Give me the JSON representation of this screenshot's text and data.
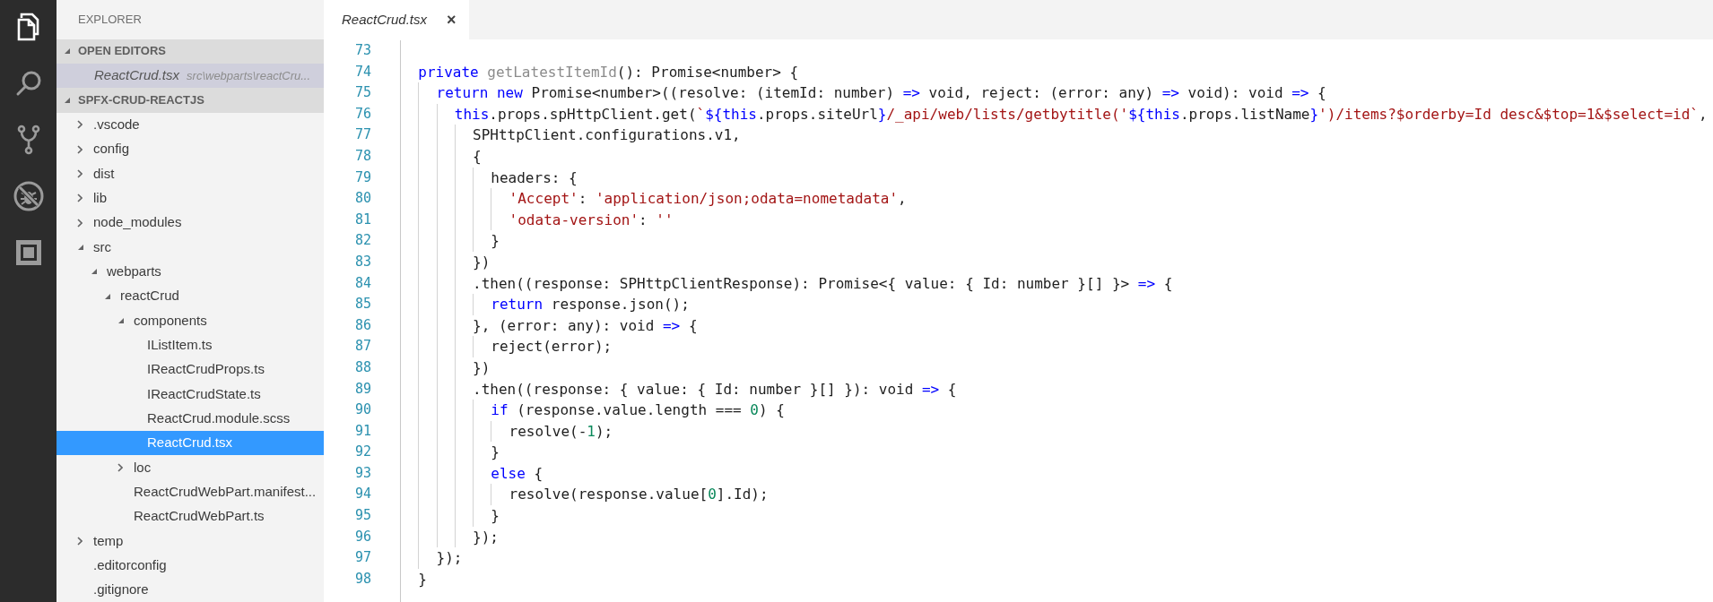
{
  "activity_bar": [
    {
      "kind": "files",
      "selected": true
    },
    {
      "kind": "search",
      "selected": false
    },
    {
      "kind": "source-control",
      "selected": false
    },
    {
      "kind": "debug",
      "selected": false
    },
    {
      "kind": "extensions",
      "selected": false
    }
  ],
  "sidebar": {
    "title": "EXPLORER",
    "open_editors": {
      "header": "OPEN EDITORS",
      "expanded": true,
      "items": [
        {
          "name": "ReactCrud.tsx",
          "path": "src\\webparts\\reactCru...",
          "selected": true
        }
      ]
    },
    "project": {
      "header": "SPFX-CRUD-REACTJS",
      "expanded": true,
      "children": [
        {
          "name": ".vscode",
          "kind": "folder",
          "expanded": false,
          "selected": false
        },
        {
          "name": "config",
          "kind": "folder",
          "expanded": false,
          "selected": false
        },
        {
          "name": "dist",
          "kind": "folder",
          "expanded": false,
          "selected": false
        },
        {
          "name": "lib",
          "kind": "folder",
          "expanded": false,
          "selected": false
        },
        {
          "name": "node_modules",
          "kind": "folder",
          "expanded": false,
          "selected": false
        },
        {
          "name": "src",
          "kind": "folder",
          "expanded": true,
          "selected": false,
          "children": [
            {
              "name": "webparts",
              "kind": "folder",
              "expanded": true,
              "selected": false,
              "children": [
                {
                  "name": "reactCrud",
                  "kind": "folder",
                  "expanded": true,
                  "selected": false,
                  "children": [
                    {
                      "name": "components",
                      "kind": "folder",
                      "expanded": true,
                      "selected": false,
                      "children": [
                        {
                          "name": "IListItem.ts",
                          "kind": "file",
                          "selected": false
                        },
                        {
                          "name": "IReactCrudProps.ts",
                          "kind": "file",
                          "selected": false
                        },
                        {
                          "name": "IReactCrudState.ts",
                          "kind": "file",
                          "selected": false
                        },
                        {
                          "name": "ReactCrud.module.scss",
                          "kind": "file",
                          "selected": false
                        },
                        {
                          "name": "ReactCrud.tsx",
                          "kind": "file",
                          "selected": true
                        }
                      ]
                    },
                    {
                      "name": "loc",
                      "kind": "folder",
                      "expanded": false,
                      "selected": false
                    },
                    {
                      "name": "ReactCrudWebPart.manifest...",
                      "kind": "file",
                      "selected": false
                    },
                    {
                      "name": "ReactCrudWebPart.ts",
                      "kind": "file",
                      "selected": false
                    }
                  ]
                }
              ]
            }
          ]
        },
        {
          "name": "temp",
          "kind": "folder",
          "expanded": false,
          "selected": false
        },
        {
          "name": ".editorconfig",
          "kind": "file",
          "selected": false
        },
        {
          "name": ".gitignore",
          "kind": "file",
          "selected": false
        }
      ]
    }
  },
  "tabs": [
    {
      "title": "ReactCrud.tsx",
      "close": "×",
      "selected": true
    }
  ],
  "editor": {
    "lines": [
      {
        "number": "73"
      },
      {
        "number": "74",
        "tokens": [
          {
            "kind": "keyword",
            "text": "  private"
          },
          {
            "kind": "unused",
            "text": " getLatestItemId"
          },
          {
            "kind": "plain",
            "text": "(): Promise<number> {"
          }
        ]
      },
      {
        "number": "75",
        "tokens": [
          {
            "kind": "keyword",
            "text": "    return new"
          },
          {
            "kind": "plain",
            "text": " Promise<number>((resolve: (itemId: number) "
          },
          {
            "kind": "keyword",
            "text": "=>"
          },
          {
            "kind": "plain",
            "text": " void, reject: (error: any) "
          },
          {
            "kind": "keyword",
            "text": "=>"
          },
          {
            "kind": "plain",
            "text": " void): void "
          },
          {
            "kind": "keyword",
            "text": "=>"
          },
          {
            "kind": "plain",
            "text": " {"
          }
        ]
      },
      {
        "number": "76",
        "tokens": [
          {
            "kind": "keyword",
            "text": "      this"
          },
          {
            "kind": "plain",
            "text": ".props.spHttpClient.get("
          },
          {
            "kind": "string",
            "text": "`"
          },
          {
            "kind": "keyword",
            "text": "${this"
          },
          {
            "kind": "plain",
            "text": ".props.siteUrl"
          },
          {
            "kind": "keyword",
            "text": "}"
          },
          {
            "kind": "string",
            "text": "/_api/web/lists/getbytitle('"
          },
          {
            "kind": "keyword",
            "text": "${this"
          },
          {
            "kind": "plain",
            "text": ".props.listName"
          },
          {
            "kind": "keyword",
            "text": "}"
          },
          {
            "kind": "string",
            "text": "')/items?$orderby=Id desc&$top=1&$select=id`"
          },
          {
            "kind": "plain",
            "text": ","
          }
        ]
      },
      {
        "number": "77",
        "tokens": [
          {
            "kind": "plain",
            "text": "        SPHttpClient.configurations.v1,"
          }
        ]
      },
      {
        "number": "78",
        "tokens": [
          {
            "kind": "plain",
            "text": "        {"
          }
        ]
      },
      {
        "number": "79",
        "tokens": [
          {
            "kind": "plain",
            "text": "          headers: {"
          }
        ]
      },
      {
        "number": "80",
        "tokens": [
          {
            "kind": "string",
            "text": "            'Accept'"
          },
          {
            "kind": "plain",
            "text": ": "
          },
          {
            "kind": "string",
            "text": "'application/json;odata=nometadata'"
          },
          {
            "kind": "plain",
            "text": ","
          }
        ]
      },
      {
        "number": "81",
        "tokens": [
          {
            "kind": "string",
            "text": "            'odata-version'"
          },
          {
            "kind": "plain",
            "text": ": "
          },
          {
            "kind": "string",
            "text": "''"
          }
        ]
      },
      {
        "number": "82",
        "tokens": [
          {
            "kind": "plain",
            "text": "          }"
          }
        ]
      },
      {
        "number": "83",
        "tokens": [
          {
            "kind": "plain",
            "text": "        })"
          }
        ]
      },
      {
        "number": "84",
        "tokens": [
          {
            "kind": "plain",
            "text": "        .then((response: SPHttpClientResponse): Promise<{ value: { Id: number }[] }> "
          },
          {
            "kind": "keyword",
            "text": "=>"
          },
          {
            "kind": "plain",
            "text": " {"
          }
        ]
      },
      {
        "number": "85",
        "tokens": [
          {
            "kind": "keyword",
            "text": "          return"
          },
          {
            "kind": "plain",
            "text": " response.json();"
          }
        ]
      },
      {
        "number": "86",
        "tokens": [
          {
            "kind": "plain",
            "text": "        }, (error: any): void "
          },
          {
            "kind": "keyword",
            "text": "=>"
          },
          {
            "kind": "plain",
            "text": " {"
          }
        ]
      },
      {
        "number": "87",
        "tokens": [
          {
            "kind": "plain",
            "text": "          reject(error);"
          }
        ]
      },
      {
        "number": "88",
        "tokens": [
          {
            "kind": "plain",
            "text": "        })"
          }
        ]
      },
      {
        "number": "89",
        "tokens": [
          {
            "kind": "plain",
            "text": "        .then((response: { value: { Id: number }[] }): void "
          },
          {
            "kind": "keyword",
            "text": "=>"
          },
          {
            "kind": "plain",
            "text": " {"
          }
        ]
      },
      {
        "number": "90",
        "tokens": [
          {
            "kind": "keyword",
            "text": "          if"
          },
          {
            "kind": "plain",
            "text": " (response.value.length === "
          },
          {
            "kind": "number",
            "text": "0"
          },
          {
            "kind": "plain",
            "text": ") {"
          }
        ]
      },
      {
        "number": "91",
        "tokens": [
          {
            "kind": "plain",
            "text": "            resolve(-"
          },
          {
            "kind": "number",
            "text": "1"
          },
          {
            "kind": "plain",
            "text": ");"
          }
        ]
      },
      {
        "number": "92",
        "tokens": [
          {
            "kind": "plain",
            "text": "          }"
          }
        ]
      },
      {
        "number": "93",
        "tokens": [
          {
            "kind": "keyword",
            "text": "          else"
          },
          {
            "kind": "plain",
            "text": " {"
          }
        ]
      },
      {
        "number": "94",
        "tokens": [
          {
            "kind": "plain",
            "text": "            resolve(response.value["
          },
          {
            "kind": "number",
            "text": "0"
          },
          {
            "kind": "plain",
            "text": "].Id);"
          }
        ]
      },
      {
        "number": "95",
        "tokens": [
          {
            "kind": "plain",
            "text": "          }"
          }
        ]
      },
      {
        "number": "96",
        "tokens": [
          {
            "kind": "plain",
            "text": "        });"
          }
        ]
      },
      {
        "number": "97",
        "tokens": [
          {
            "kind": "plain",
            "text": "    });"
          }
        ]
      },
      {
        "number": "98",
        "tokens": [
          {
            "kind": "plain",
            "text": "  }"
          }
        ]
      }
    ]
  }
}
